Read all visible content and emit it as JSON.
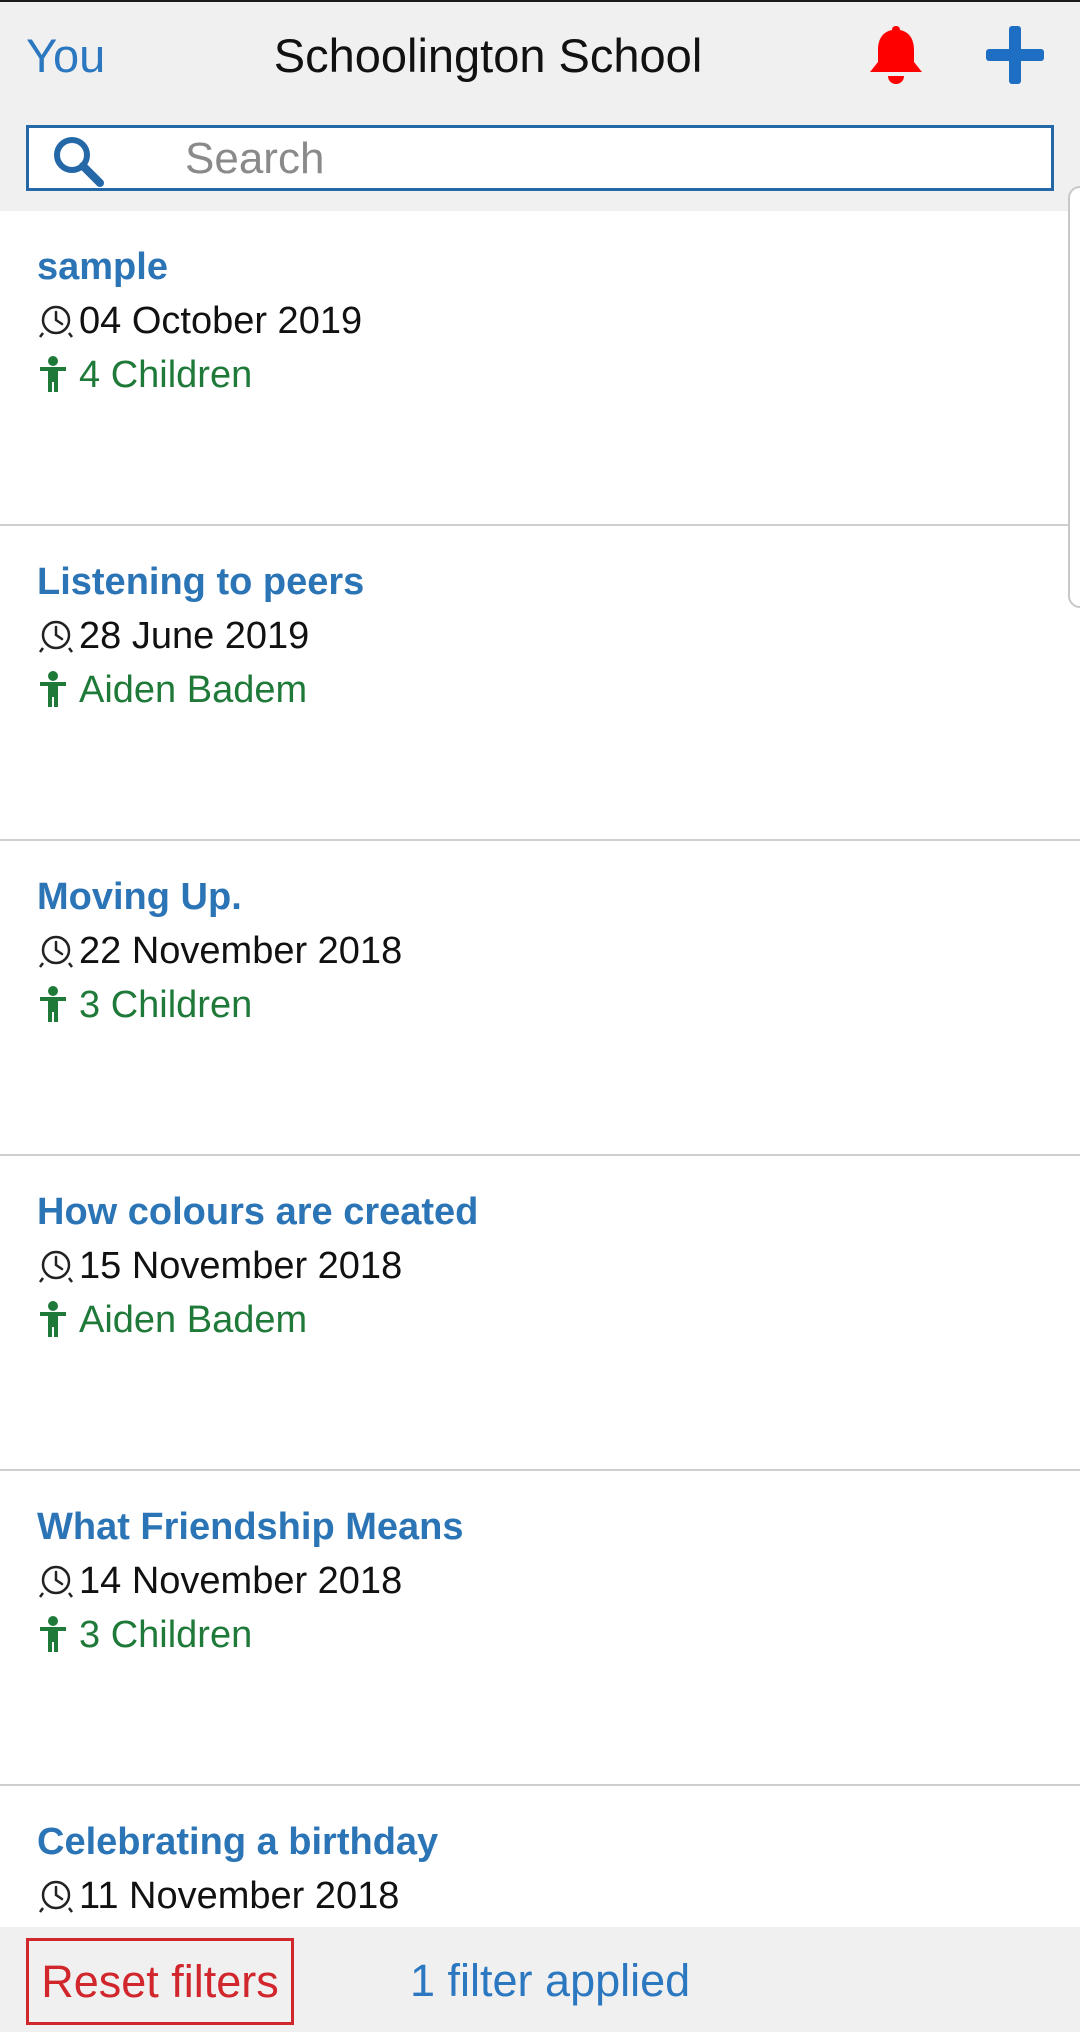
{
  "header": {
    "you_label": "You",
    "title": "Schoolington School",
    "bell_icon": "bell-icon",
    "add_icon": "plus-icon",
    "bell_color": "#ff0000",
    "accent_color": "#2b78c0"
  },
  "search": {
    "placeholder": "Search",
    "value": "",
    "icon": "search-icon"
  },
  "observations": [
    {
      "title": "sample",
      "date": "04 October 2019",
      "who": "4 Children"
    },
    {
      "title": "Listening to peers",
      "date": "28 June 2019",
      "who": "Aiden Badem"
    },
    {
      "title": "Moving Up.",
      "date": "22 November 2018",
      "who": "3 Children"
    },
    {
      "title": "How colours are created",
      "date": "15 November 2018",
      "who": "Aiden Badem"
    },
    {
      "title": "What Friendship Means",
      "date": "14 November 2018",
      "who": "3 Children"
    },
    {
      "title": "Celebrating a birthday",
      "date": "11 November 2018",
      "who": ""
    }
  ],
  "footer": {
    "reset_label": "Reset filters",
    "filter_status": "1 filter applied"
  }
}
